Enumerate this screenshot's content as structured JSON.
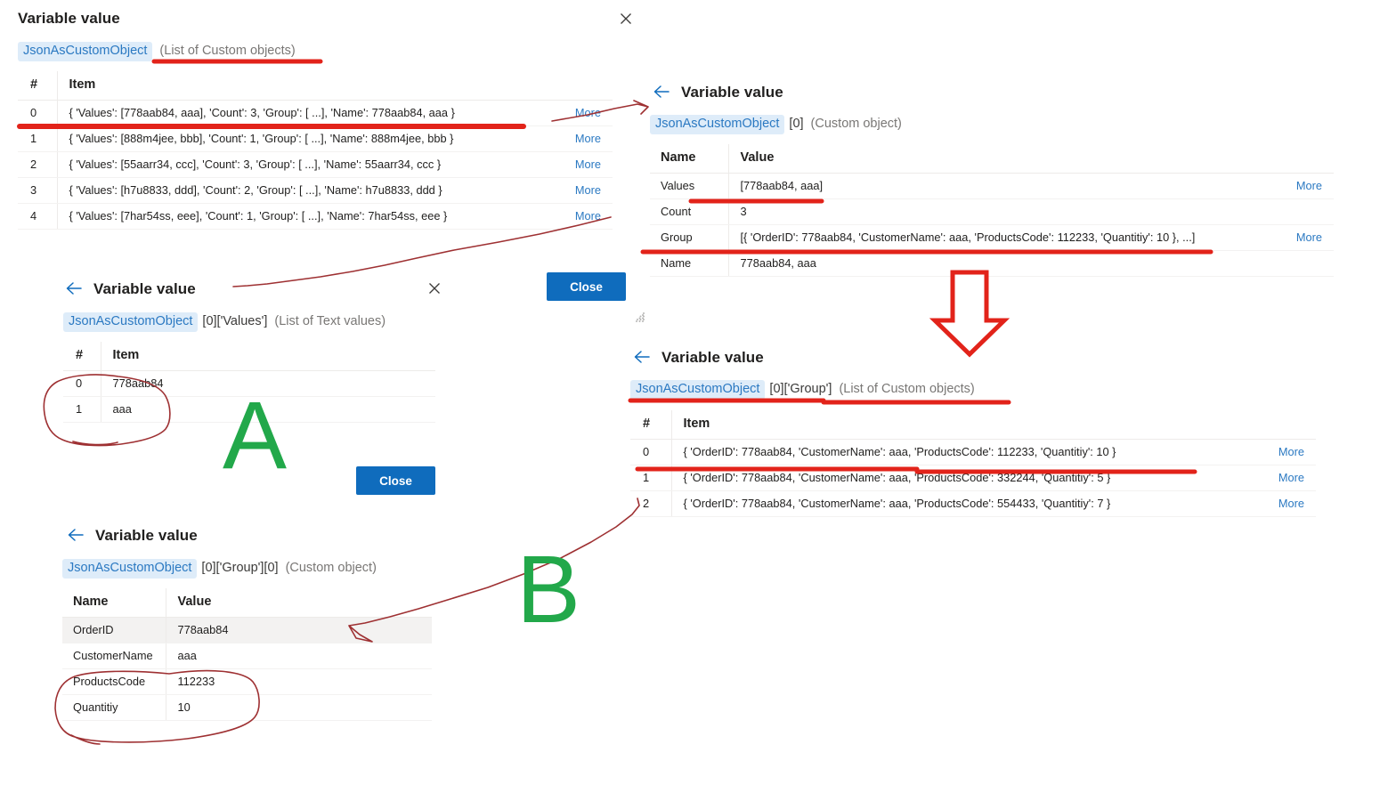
{
  "common": {
    "title": "Variable value",
    "chip": "JsonAsCustomObject",
    "more_label": "More",
    "close_label": "Close",
    "col_hash": "#",
    "col_item": "Item",
    "col_name": "Name",
    "col_value": "Value",
    "accent_blue": "#0f6cbd",
    "link_blue": "#2b79c2",
    "chip_bg": "#deecf9",
    "annotation_red": "#b02a2a",
    "marker_red": "#e2231a",
    "marker_green": "#22a84a"
  },
  "panel_root": {
    "title": "Variable value",
    "chip": "JsonAsCustomObject",
    "index": "",
    "kind": "(List of Custom objects)",
    "headers": {
      "num": "#",
      "item": "Item"
    },
    "rows": [
      {
        "num": "0",
        "item": "{ 'Values': [778aab84, aaa], 'Count': 3, 'Group': [ ...], 'Name': 778aab84, aaa }",
        "more": "More"
      },
      {
        "num": "1",
        "item": "{ 'Values': [888m4jee, bbb], 'Count': 1, 'Group': [ ...], 'Name': 888m4jee, bbb }",
        "more": "More"
      },
      {
        "num": "2",
        "item": "{ 'Values': [55aarr34, ccc], 'Count': 3, 'Group': [ ...], 'Name': 55aarr34, ccc }",
        "more": "More"
      },
      {
        "num": "3",
        "item": "{ 'Values': [h7u8833, ddd], 'Count': 2, 'Group': [ ...], 'Name': h7u8833, ddd }",
        "more": "More"
      },
      {
        "num": "4",
        "item": "{ 'Values': [7har54ss, eee], 'Count': 1, 'Group': [ ...], 'Name': 7har54ss, eee }",
        "more": "More"
      }
    ],
    "close_button": "Close"
  },
  "panel_item0": {
    "title": "Variable value",
    "chip": "JsonAsCustomObject",
    "index": "[0]",
    "kind": "(Custom object)",
    "headers": {
      "name": "Name",
      "value": "Value"
    },
    "rows": [
      {
        "name": "Values",
        "value": "[778aab84, aaa]",
        "more": "More"
      },
      {
        "name": "Count",
        "value": "3",
        "more": ""
      },
      {
        "name": "Group",
        "value": "[{ 'OrderID': 778aab84, 'CustomerName': aaa, 'ProductsCode': 112233, 'Quantitiy': 10 },  ...]",
        "more": "More"
      },
      {
        "name": "Name",
        "value": "778aab84, aaa",
        "more": ""
      }
    ]
  },
  "panel_values": {
    "title": "Variable value",
    "chip": "JsonAsCustomObject",
    "index": "[0]['Values']",
    "kind": "(List of Text values)",
    "headers": {
      "num": "#",
      "item": "Item"
    },
    "rows": [
      {
        "num": "0",
        "item": "778aab84"
      },
      {
        "num": "1",
        "item": "aaa"
      }
    ],
    "close_button": "Close"
  },
  "panel_group_list": {
    "title": "Variable value",
    "chip": "JsonAsCustomObject",
    "index": "[0]['Group']",
    "kind": "(List of Custom objects)",
    "headers": {
      "num": "#",
      "item": "Item"
    },
    "rows": [
      {
        "num": "0",
        "item": "{ 'OrderID': 778aab84, 'CustomerName': aaa, 'ProductsCode': 112233, 'Quantitiy': 10 }",
        "more": "More"
      },
      {
        "num": "1",
        "item": "{ 'OrderID': 778aab84, 'CustomerName': aaa, 'ProductsCode': 332244, 'Quantitiy': 5 }",
        "more": "More"
      },
      {
        "num": "2",
        "item": "{ 'OrderID': 778aab84, 'CustomerName': aaa, 'ProductsCode': 554433, 'Quantitiy': 7 }",
        "more": "More"
      }
    ]
  },
  "panel_group0": {
    "title": "Variable value",
    "chip": "JsonAsCustomObject",
    "index": "[0]['Group'][0]",
    "kind": "(Custom object)",
    "headers": {
      "name": "Name",
      "value": "Value"
    },
    "rows": [
      {
        "name": "OrderID",
        "value": "778aab84",
        "hover": true
      },
      {
        "name": "CustomerName",
        "value": "aaa",
        "hover": false
      },
      {
        "name": "ProductsCode",
        "value": "112233",
        "hover": false
      },
      {
        "name": "Quantitiy",
        "value": "10",
        "hover": false
      }
    ]
  },
  "annotations": {
    "letter_a": "A",
    "letter_b": "B"
  }
}
